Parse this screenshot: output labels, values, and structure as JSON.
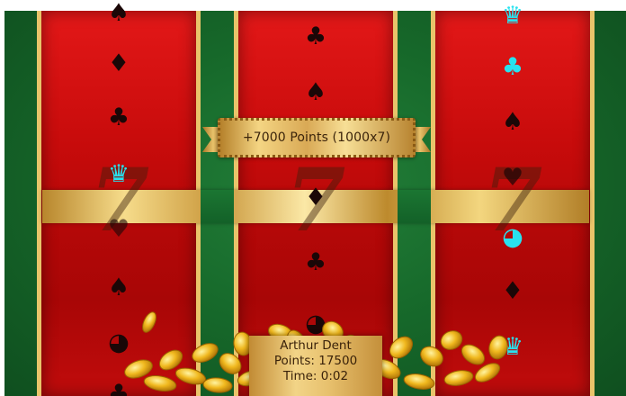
{
  "banner": {
    "text": "+7000 Points (1000x7)"
  },
  "player": {
    "name": "Arthur Dent",
    "points_text": "Points: 17500",
    "time_text": "Time: 0:02"
  },
  "reels": [
    {
      "id": "reel-1",
      "payline_symbol": "seven",
      "symbols": [
        "spade",
        "diamond",
        "club",
        "crown",
        "heart",
        "spade",
        "pacman",
        "club"
      ]
    },
    {
      "id": "reel-2",
      "payline_symbol": "seven",
      "symbols": [
        "club",
        "spade",
        "spade",
        "diamond",
        "club",
        "pacman"
      ]
    },
    {
      "id": "reel-3",
      "payline_symbol": "seven",
      "symbols": [
        "crown",
        "club",
        "spade",
        "heart",
        "pacman",
        "diamond",
        "crown"
      ]
    }
  ],
  "colors": {
    "felt": "#176a2b",
    "reel": "#c70b0b",
    "gold": "#e9c46a",
    "symbol_dark": "#1a0707",
    "symbol_highlight": "#28e2ef"
  }
}
